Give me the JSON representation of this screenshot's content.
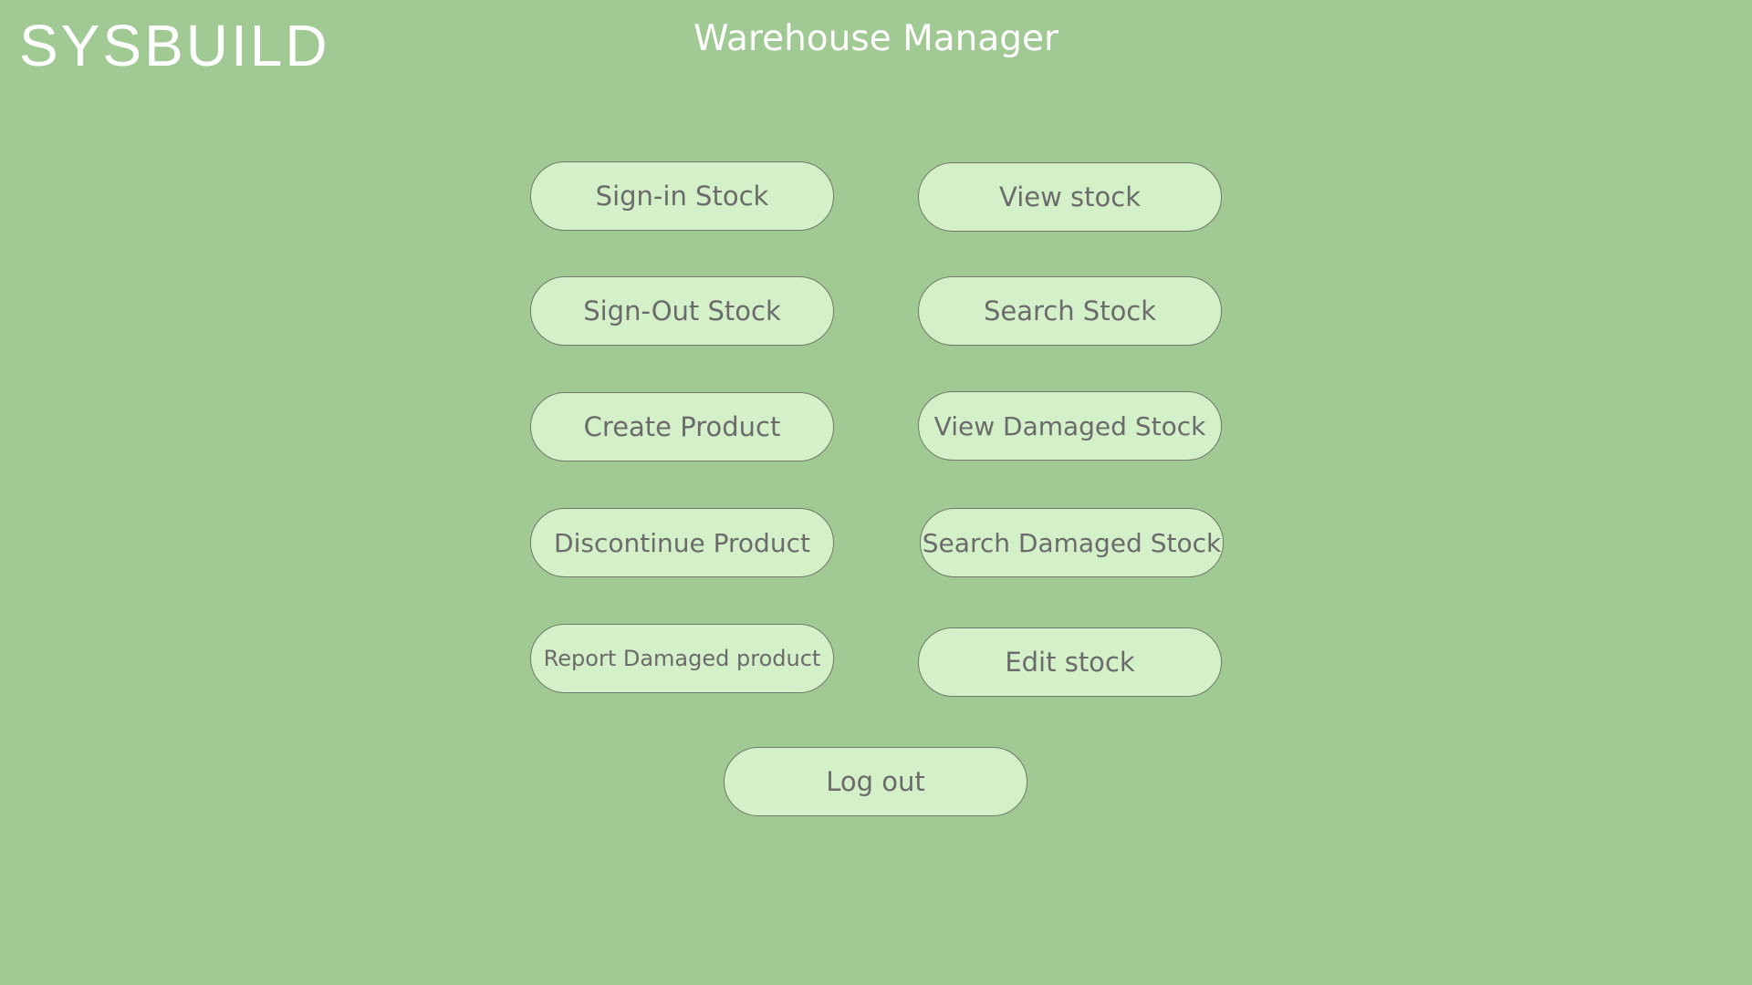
{
  "app": {
    "logo": "SYSBUILD",
    "title": "Warehouse Manager"
  },
  "buttons": {
    "sign_in_stock": "Sign-in Stock",
    "view_stock": "View stock",
    "sign_out_stock": "Sign-Out Stock",
    "search_stock": "Search Stock",
    "create_product": "Create Product",
    "view_damaged_stock": "View Damaged Stock",
    "discontinue_product": "Discontinue Product",
    "search_damaged_stock": "Search Damaged Stock",
    "report_damaged_product": "Report Damaged product",
    "edit_stock": "Edit stock",
    "log_out": "Log out"
  },
  "colors": {
    "background": "#a1c993",
    "button_fill": "#d4f0c9",
    "button_border": "#6e7a6a",
    "button_text": "#6b6b6b",
    "header_text": "#ffffff"
  }
}
